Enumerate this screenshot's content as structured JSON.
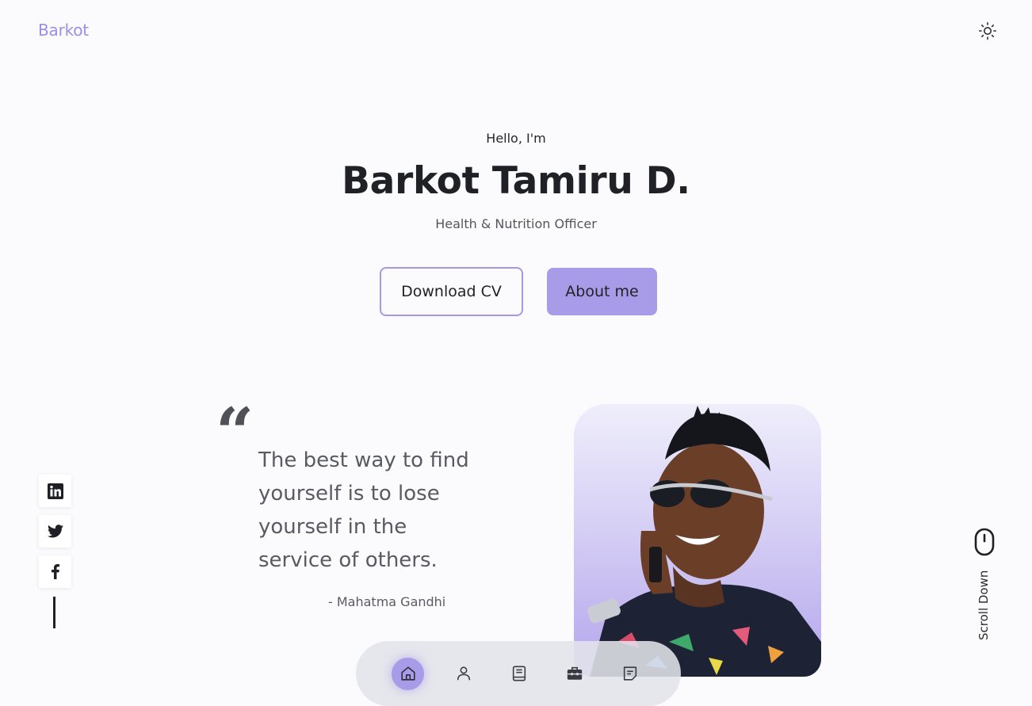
{
  "header": {
    "logo": "Barkot",
    "theme_toggle_icon": "sun-icon"
  },
  "hero": {
    "greeting": "Hello, I'm",
    "name": "Barkot Tamiru D.",
    "role": "Health & Nutrition Officer",
    "download_cv_label": "Download CV",
    "about_me_label": "About me"
  },
  "quote": {
    "mark": "“",
    "text": "The best way to find yourself is to lose yourself in the service of others.",
    "author": "- Mahatma Gandhi"
  },
  "social": {
    "icons": [
      "linkedin-icon",
      "twitter-icon",
      "facebook-icon"
    ]
  },
  "scroll": {
    "label": "Scroll Down",
    "icon": "mouse-icon"
  },
  "nav": {
    "items": [
      {
        "icon": "home-icon",
        "active": true
      },
      {
        "icon": "user-icon",
        "active": false
      },
      {
        "icon": "book-icon",
        "active": false
      },
      {
        "icon": "briefcase-icon",
        "active": false
      },
      {
        "icon": "message-icon",
        "active": false
      }
    ]
  },
  "colors": {
    "accent": "#a89be8",
    "logo": "#9f8ee6",
    "background": "#fbfbfe",
    "text": "#222227"
  }
}
